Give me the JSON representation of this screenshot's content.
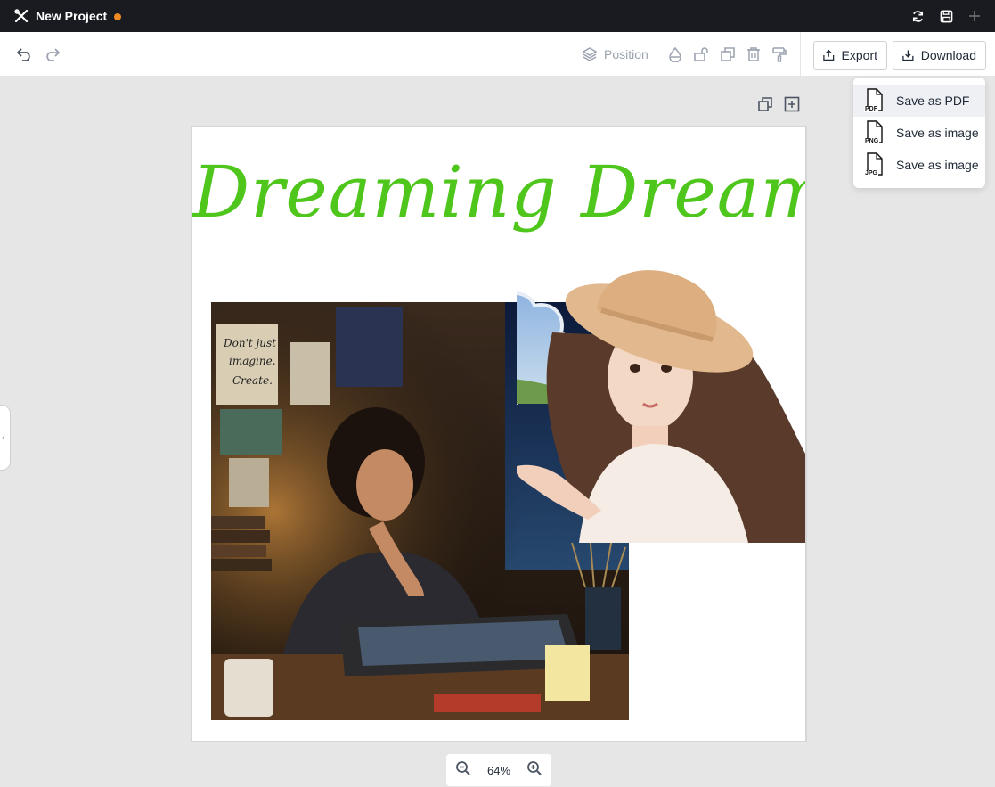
{
  "titlebar": {
    "title": "New Project",
    "unsaved_dot_color": "#f08a24",
    "icons": [
      "tools-icon",
      "sync-icon",
      "save-icon",
      "plus-icon"
    ]
  },
  "toolbar": {
    "position_label": "Position",
    "export_label": "Export",
    "download_label": "Download"
  },
  "canvas": {
    "headline": "Dreaming Dreamer!",
    "headline_color": "#4fc61c",
    "image1_alt": "Girl dreaming at a desk with a drawing tablet",
    "image2_alt": "Girl in a straw hat with a dream bubble"
  },
  "zoom": {
    "value": "64%"
  },
  "download_menu": {
    "items": [
      {
        "badge": "PDF",
        "label": "Save as PDF"
      },
      {
        "badge": "PNG",
        "label": "Save as image"
      },
      {
        "badge": "JPG",
        "label": "Save as image"
      }
    ]
  }
}
